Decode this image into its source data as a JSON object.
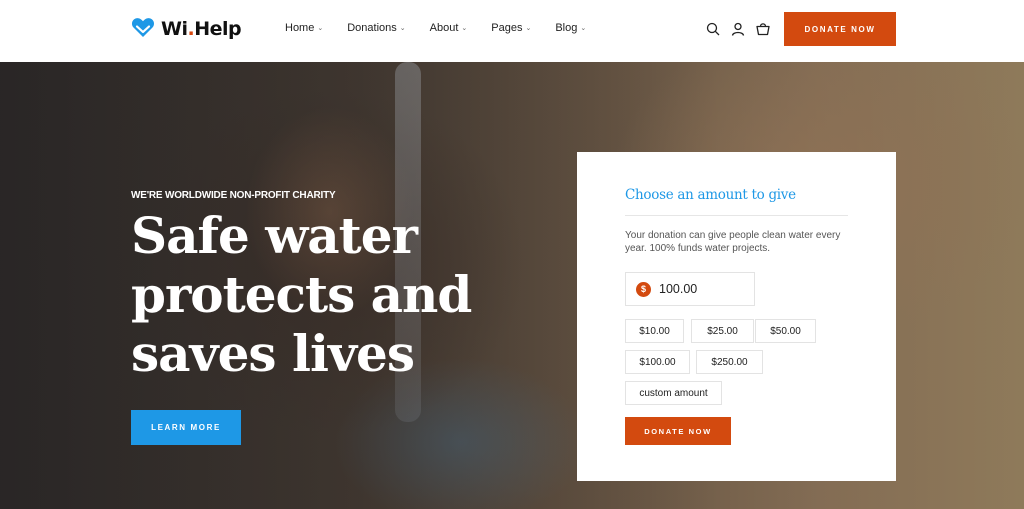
{
  "brand": {
    "name": "Wi",
    "dot": ".",
    "suffix": "Help",
    "logo_icon": "heart-icon",
    "accent": "#1e98e6"
  },
  "nav": {
    "items": [
      {
        "label": "Home"
      },
      {
        "label": "Donations"
      },
      {
        "label": "About"
      },
      {
        "label": "Pages"
      },
      {
        "label": "Blog"
      }
    ]
  },
  "header": {
    "icons": [
      "search-icon",
      "user-icon",
      "cart-icon"
    ],
    "donate_label": "DONATE NOW",
    "donate_color": "#d34a0f"
  },
  "hero": {
    "tagline": "WE'RE WORLDWIDE NON-PROFIT CHARITY",
    "headline": "Safe water protects and saves lives",
    "cta_label": "LEARN MORE"
  },
  "donation": {
    "title": "Choose an amount to give",
    "description": "Your donation can give people clean water every year. 100% funds water projects.",
    "currency_symbol": "$",
    "amount_value": "100.00",
    "presets": [
      "$10.00",
      "$25.00",
      "$50.00",
      "$100.00",
      "$250.00",
      "custom amount"
    ],
    "submit_label": "DONATE NOW"
  }
}
